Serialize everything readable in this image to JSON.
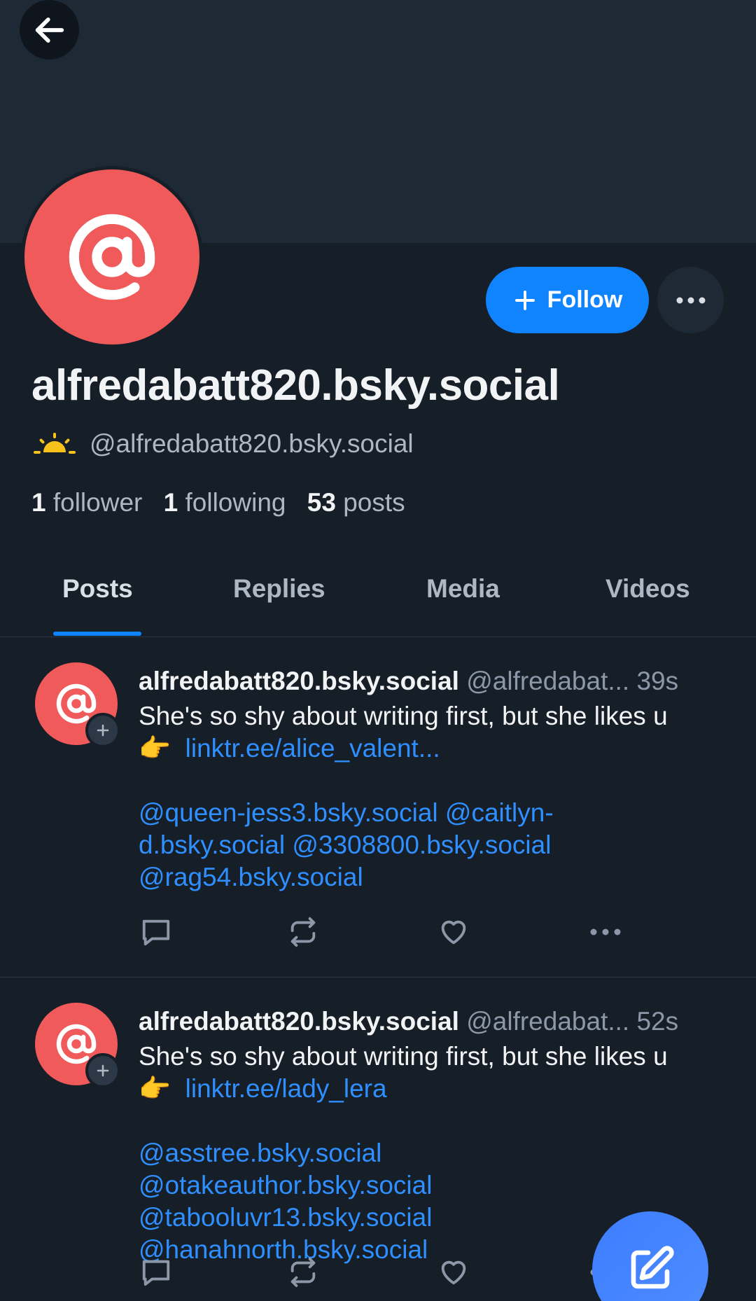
{
  "profile": {
    "display_name": "alfredabatt820.bsky.social",
    "handle": "@alfredabatt820.bsky.social",
    "stats": {
      "followers_count": "1",
      "followers_label": "follower",
      "following_count": "1",
      "following_label": "following",
      "posts_count": "53",
      "posts_label": "posts"
    },
    "follow_label": "Follow"
  },
  "tabs": [
    {
      "label": "Posts",
      "active": true
    },
    {
      "label": "Replies",
      "active": false
    },
    {
      "label": "Media",
      "active": false
    },
    {
      "label": "Videos",
      "active": false
    }
  ],
  "posts": [
    {
      "name": "alfredabatt820.bsky.social",
      "handle": "@alfredabat...",
      "time": "39s",
      "text": "She's so shy about writing first, but she likes u",
      "emoji": "👉",
      "link": "linktr.ee/alice_valent...",
      "mentions": " @queen-jess3.bsky.social @caitlyn-d.bsky.social @3308800.bsky.social @rag54.bsky.social"
    },
    {
      "name": "alfredabatt820.bsky.social",
      "handle": "@alfredabat...",
      "time": "52s",
      "text": "She's so shy about writing first, but she likes u",
      "emoji": "👉",
      "link": "linktr.ee/lady_lera",
      "mentions": " @asstree.bsky.social @otakeauthor.bsky.social @tabooluvr13.bsky.social @hanahnorth.bsky.social"
    }
  ],
  "colors": {
    "accent": "#1083fe",
    "avatar": "#f05a5b",
    "link": "#2f8fff",
    "background": "#161e27"
  }
}
